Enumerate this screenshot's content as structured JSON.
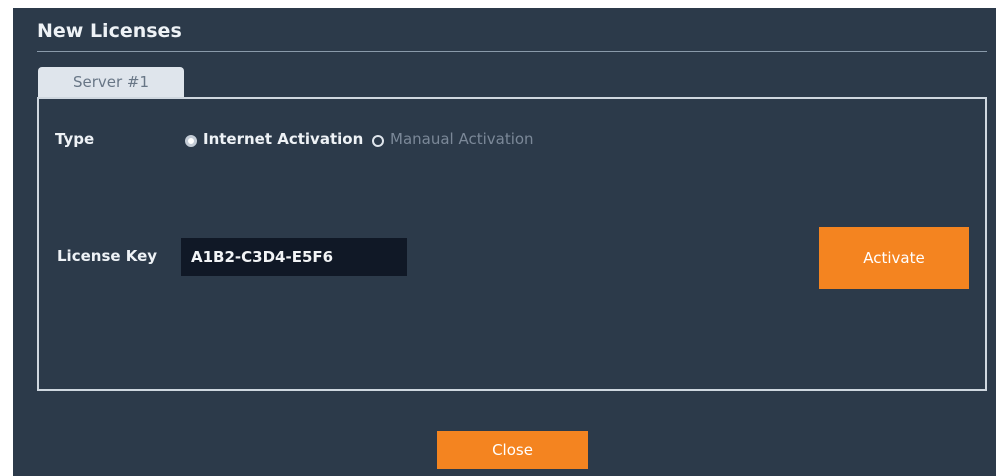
{
  "dialog": {
    "title": "New Licenses",
    "tabs": [
      {
        "label": "Server #1",
        "active": true
      }
    ],
    "type_label": "Type",
    "activation_options": [
      {
        "label": "Internet Activation",
        "selected": true
      },
      {
        "label": "Manaual Activation",
        "selected": false
      }
    ],
    "license_key_label": "License Key",
    "license_key_value": "A1B2-C3D4-E5F6",
    "activate_label": "Activate",
    "close_label": "Close"
  },
  "colors": {
    "background": "#2c3a4a",
    "accent": "#f48420",
    "input_bg": "#101826",
    "tab_bg": "#dfe5ec"
  }
}
